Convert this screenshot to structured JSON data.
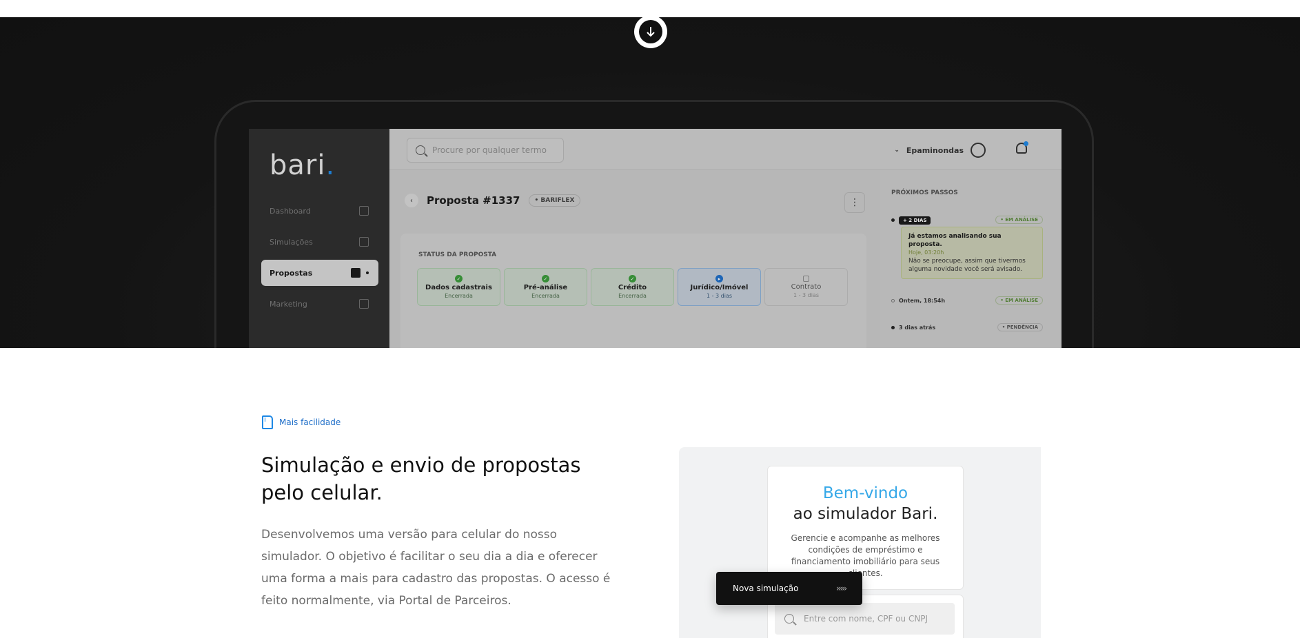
{
  "hero": {
    "app": {
      "logo_text": "bari",
      "logo_dot": ".",
      "search_placeholder": "Procure por qualquer termo",
      "user_name": "Epaminondas",
      "nav": [
        {
          "label": "Dashboard",
          "icon": "grid-icon"
        },
        {
          "label": "Simulações",
          "icon": "document-icon"
        },
        {
          "label": "Propostas",
          "icon": "folder-icon",
          "active": true
        },
        {
          "label": "Marketing",
          "icon": "megaphone-icon"
        }
      ],
      "proposal_title": "Proposta #1337",
      "proposal_tag": "• BARIFLEX",
      "more_glyph": "⋮",
      "status_label": "STATUS DA PROPOSTA",
      "steps": [
        {
          "name": "Dados cadastrais",
          "sub": "Encerrada",
          "state": "done"
        },
        {
          "name": "Pré-análise",
          "sub": "Encerrada",
          "state": "done"
        },
        {
          "name": "Crédito",
          "sub": "Encerrada",
          "state": "done"
        },
        {
          "name": "Jurídico/Imóvel",
          "sub": "1 - 3 dias",
          "state": "current"
        },
        {
          "name": "Contrato",
          "sub": "1 - 3 dias",
          "state": "pending"
        }
      ],
      "next_label": "PRÓXIMOS PASSOS",
      "timeline": {
        "chip": "+ 2 DIAS",
        "status1": "• EM ANÁLISE",
        "note_title": "Já estamos analisando sua proposta.",
        "note_date": "Hoje, 03:20h",
        "note_body": "Não se preocupe, assim que tivermos alguma novidade você será avisado.",
        "row2_text": "Ontem, 18:54h",
        "status2": "• EM ANÁLISE",
        "row3_text": "3 dias atrás",
        "status3": "• PENDÊNCIA"
      }
    }
  },
  "feature": {
    "tag": "Mais facilidade",
    "headline": "Simulação e envio de propostas pelo celular.",
    "paragraph": "Desenvolvemos uma versão para celular do nosso simulador. O objetivo é facilitar o seu dia a dia e oferecer uma forma a mais para cadastro das propostas. O acesso é feito normalmente, via Portal de Parceiros."
  },
  "phone": {
    "welcome_title": "Bem-vindo",
    "welcome_sub": "ao simulador Bari.",
    "welcome_desc": "Gerencie e acompanhe as melhores condições de empréstimo e financiamento imobiliário para seus clientes.",
    "search_placeholder": "Entre com nome, CPF ou CNPJ",
    "new_sim_label": "Nova simulação",
    "arrows_glyph": "›››››"
  },
  "colors": {
    "accent": "#1e88e5",
    "hero_bg": "#1a1a1a",
    "welcome_blue": "#35a8e8"
  }
}
